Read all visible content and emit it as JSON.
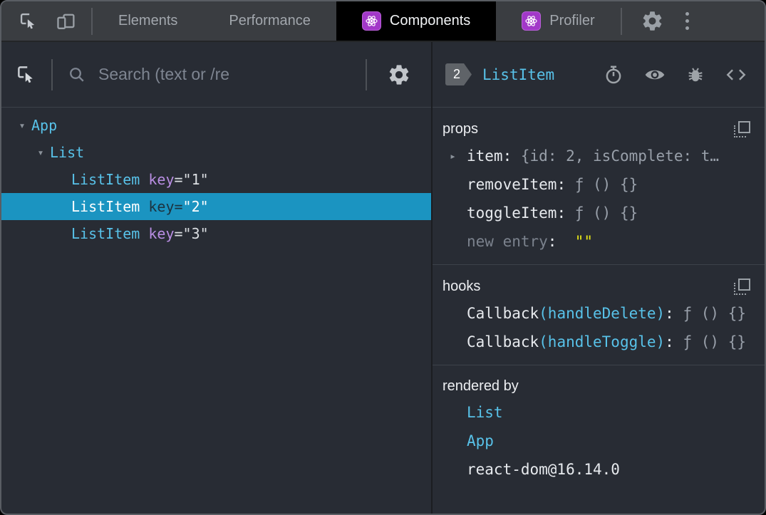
{
  "syntax": {
    "eq": "=",
    "colon": ":"
  },
  "tabbar": {
    "tabs": {
      "elements": "Elements",
      "performance": "Performance",
      "components": "Components",
      "profiler": "Profiler"
    }
  },
  "left_toolbar": {
    "search_placeholder": "Search (text or /re"
  },
  "tree": {
    "rows": [
      {
        "arrow": "▾",
        "label": "App"
      },
      {
        "arrow": "▾",
        "label": "List"
      },
      {
        "label": "ListItem",
        "attr": "key",
        "value": "\"1\""
      },
      {
        "label": "ListItem",
        "attr": "key",
        "value": "\"2\"",
        "selected": true
      },
      {
        "label": "ListItem",
        "attr": "key",
        "value": "\"3\""
      }
    ]
  },
  "inspector": {
    "badge": "2",
    "title": "ListItem",
    "props": {
      "heading": "props",
      "rows": [
        {
          "arrow": "▸",
          "name": "item",
          "value": "{id: 2, isComplete: t…"
        },
        {
          "name": "removeItem",
          "value": "ƒ () {}"
        },
        {
          "name": "toggleItem",
          "value": "ƒ () {}"
        },
        {
          "name": "new entry",
          "value": "\"\""
        }
      ]
    },
    "hooks": {
      "heading": "hooks",
      "rows": [
        {
          "kind": "Callback",
          "fn": "(handleDelete)",
          "value": "ƒ () {}"
        },
        {
          "kind": "Callback",
          "fn": "(handleToggle)",
          "value": "ƒ () {}"
        }
      ]
    },
    "rendered_by": {
      "heading": "rendered by",
      "items": [
        "List",
        "App",
        "react-dom@16.14.0"
      ]
    }
  },
  "icons": {
    "topbar": [
      "inspect-icon",
      "device-toolbar-icon",
      "react-logo-icon",
      "gear-icon",
      "kebab-menu-icon"
    ],
    "left_toolbar": [
      "inspect-icon",
      "search-icon",
      "gear-icon"
    ],
    "right_toolbar": [
      "stopwatch-icon",
      "eye-icon",
      "bug-icon",
      "code-brackets-icon"
    ],
    "sections": [
      "copy-icon"
    ]
  },
  "colors": {
    "component_cyan": "#58c2e9",
    "attribute_purple": "#b98ee3",
    "selected_row_blue": "#1b94c1",
    "string_yellow": "#e5e516",
    "react_badge_purple": "#a238c8",
    "panel_background": "#282c34",
    "topbar_background": "#3a3d41"
  }
}
